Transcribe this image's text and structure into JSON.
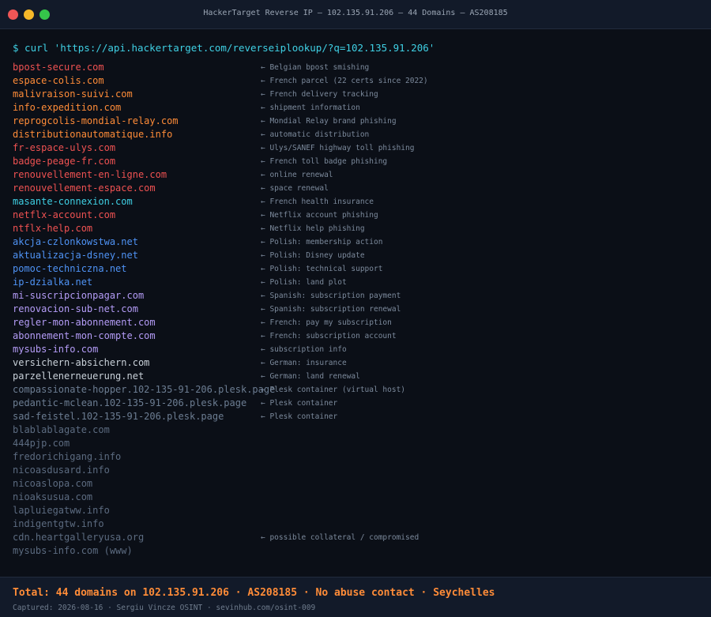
{
  "window": {
    "title": "HackerTarget Reverse IP — 102.135.91.206 — 44 Domains — AS208185"
  },
  "terminal": {
    "command": "$ curl 'https://api.hackertarget.com/reverseiplookup/?q=102.135.91.206'",
    "rows": [
      {
        "domain": "bpost-secure.com",
        "note": "← Belgian bpost smishing",
        "color": "#f05252"
      },
      {
        "domain": "espace-colis.com",
        "note": "← French parcel (22 certs since 2022)",
        "color": "#ff8c38"
      },
      {
        "domain": "malivraison-suivi.com",
        "note": "← French delivery tracking",
        "color": "#ff8c38"
      },
      {
        "domain": "info-expedition.com",
        "note": "← shipment information",
        "color": "#ff8c38"
      },
      {
        "domain": "reprogcolis-mondial-relay.com",
        "note": "← Mondial Relay brand phishing",
        "color": "#ff8c38"
      },
      {
        "domain": "distributionautomatique.info",
        "note": "← automatic distribution",
        "color": "#ff8c38"
      },
      {
        "domain": "fr-espace-ulys.com",
        "note": "← Ulys/SANEF highway toll phishing",
        "color": "#f05252"
      },
      {
        "domain": "badge-peage-fr.com",
        "note": "← French toll badge phishing",
        "color": "#f05252"
      },
      {
        "domain": "renouvellement-en-ligne.com",
        "note": "← online renewal",
        "color": "#f05252"
      },
      {
        "domain": "renouvellement-espace.com",
        "note": "← space renewal",
        "color": "#f05252"
      },
      {
        "domain": "masante-connexion.com",
        "note": "← French health insurance",
        "color": "#3fd0e4"
      },
      {
        "domain": "netflx-account.com",
        "note": "← Netflix account phishing",
        "color": "#f05252"
      },
      {
        "domain": "ntflx-help.com",
        "note": "← Netflix help phishing",
        "color": "#f05252"
      },
      {
        "domain": "akcja-czlonkowstwa.net",
        "note": "← Polish: membership action",
        "color": "#4f93f5"
      },
      {
        "domain": "aktualizacja-dsney.net",
        "note": "← Polish: Disney update",
        "color": "#4f93f5"
      },
      {
        "domain": "pomoc-techniczna.net",
        "note": "← Polish: technical support",
        "color": "#4f93f5"
      },
      {
        "domain": "ip-dzialka.net",
        "note": "← Polish: land plot",
        "color": "#4f93f5"
      },
      {
        "domain": "mi-suscripcionpagar.com",
        "note": "← Spanish: subscription payment",
        "color": "#b49cf7"
      },
      {
        "domain": "renovacion-sub-net.com",
        "note": "← Spanish: subscription renewal",
        "color": "#b49cf7"
      },
      {
        "domain": "regler-mon-abonnement.com",
        "note": "← French: pay my subscription",
        "color": "#b49cf7"
      },
      {
        "domain": "abonnement-mon-compte.com",
        "note": "← French: subscription account",
        "color": "#b49cf7"
      },
      {
        "domain": "mysubs-info.com",
        "note": "← subscription info",
        "color": "#b49cf7"
      },
      {
        "domain": "versichern-absichern.com",
        "note": "← German: insurance",
        "color": "#c9d1d9"
      },
      {
        "domain": "parzellenerneuerung.net",
        "note": "← German: land renewal",
        "color": "#c9d1d9"
      },
      {
        "domain": "compassionate-hopper.102-135-91-206.plesk.page",
        "note": "← Plesk container (virtual host)",
        "color": "#6c7d92"
      },
      {
        "domain": "pedantic-mclean.102-135-91-206.plesk.page",
        "note": "← Plesk container",
        "color": "#6c7d92"
      },
      {
        "domain": "sad-feistel.102-135-91-206.plesk.page",
        "note": "← Plesk container",
        "color": "#6c7d92"
      },
      {
        "domain": "blablablagate.com",
        "note": "",
        "color": "#5c6b80"
      },
      {
        "domain": "444pjp.com",
        "note": "",
        "color": "#5c6b80"
      },
      {
        "domain": "fredorichigang.info",
        "note": "",
        "color": "#5c6b80"
      },
      {
        "domain": "nicoasdusard.info",
        "note": "",
        "color": "#5c6b80"
      },
      {
        "domain": "nicoaslopa.com",
        "note": "",
        "color": "#5c6b80"
      },
      {
        "domain": "nioaksusua.com",
        "note": "",
        "color": "#5c6b80"
      },
      {
        "domain": "lapluiegatww.info",
        "note": "",
        "color": "#5c6b80"
      },
      {
        "domain": "indigentgtw.info",
        "note": "",
        "color": "#5c6b80"
      },
      {
        "domain": "cdn.heartgalleryusa.org",
        "note": "← possible collateral / compromised",
        "color": "#5c6b80"
      },
      {
        "domain": "mysubs-info.com (www)",
        "note": "",
        "color": "#5c6b80"
      }
    ]
  },
  "footer": {
    "total": "Total: 44 domains on 102.135.91.206 · AS208185 · No abuse contact · Seychelles",
    "captured": "Captured: 2026-08-16 · Sergiu Vincze OSINT · sevinhub.com/osint-009"
  }
}
